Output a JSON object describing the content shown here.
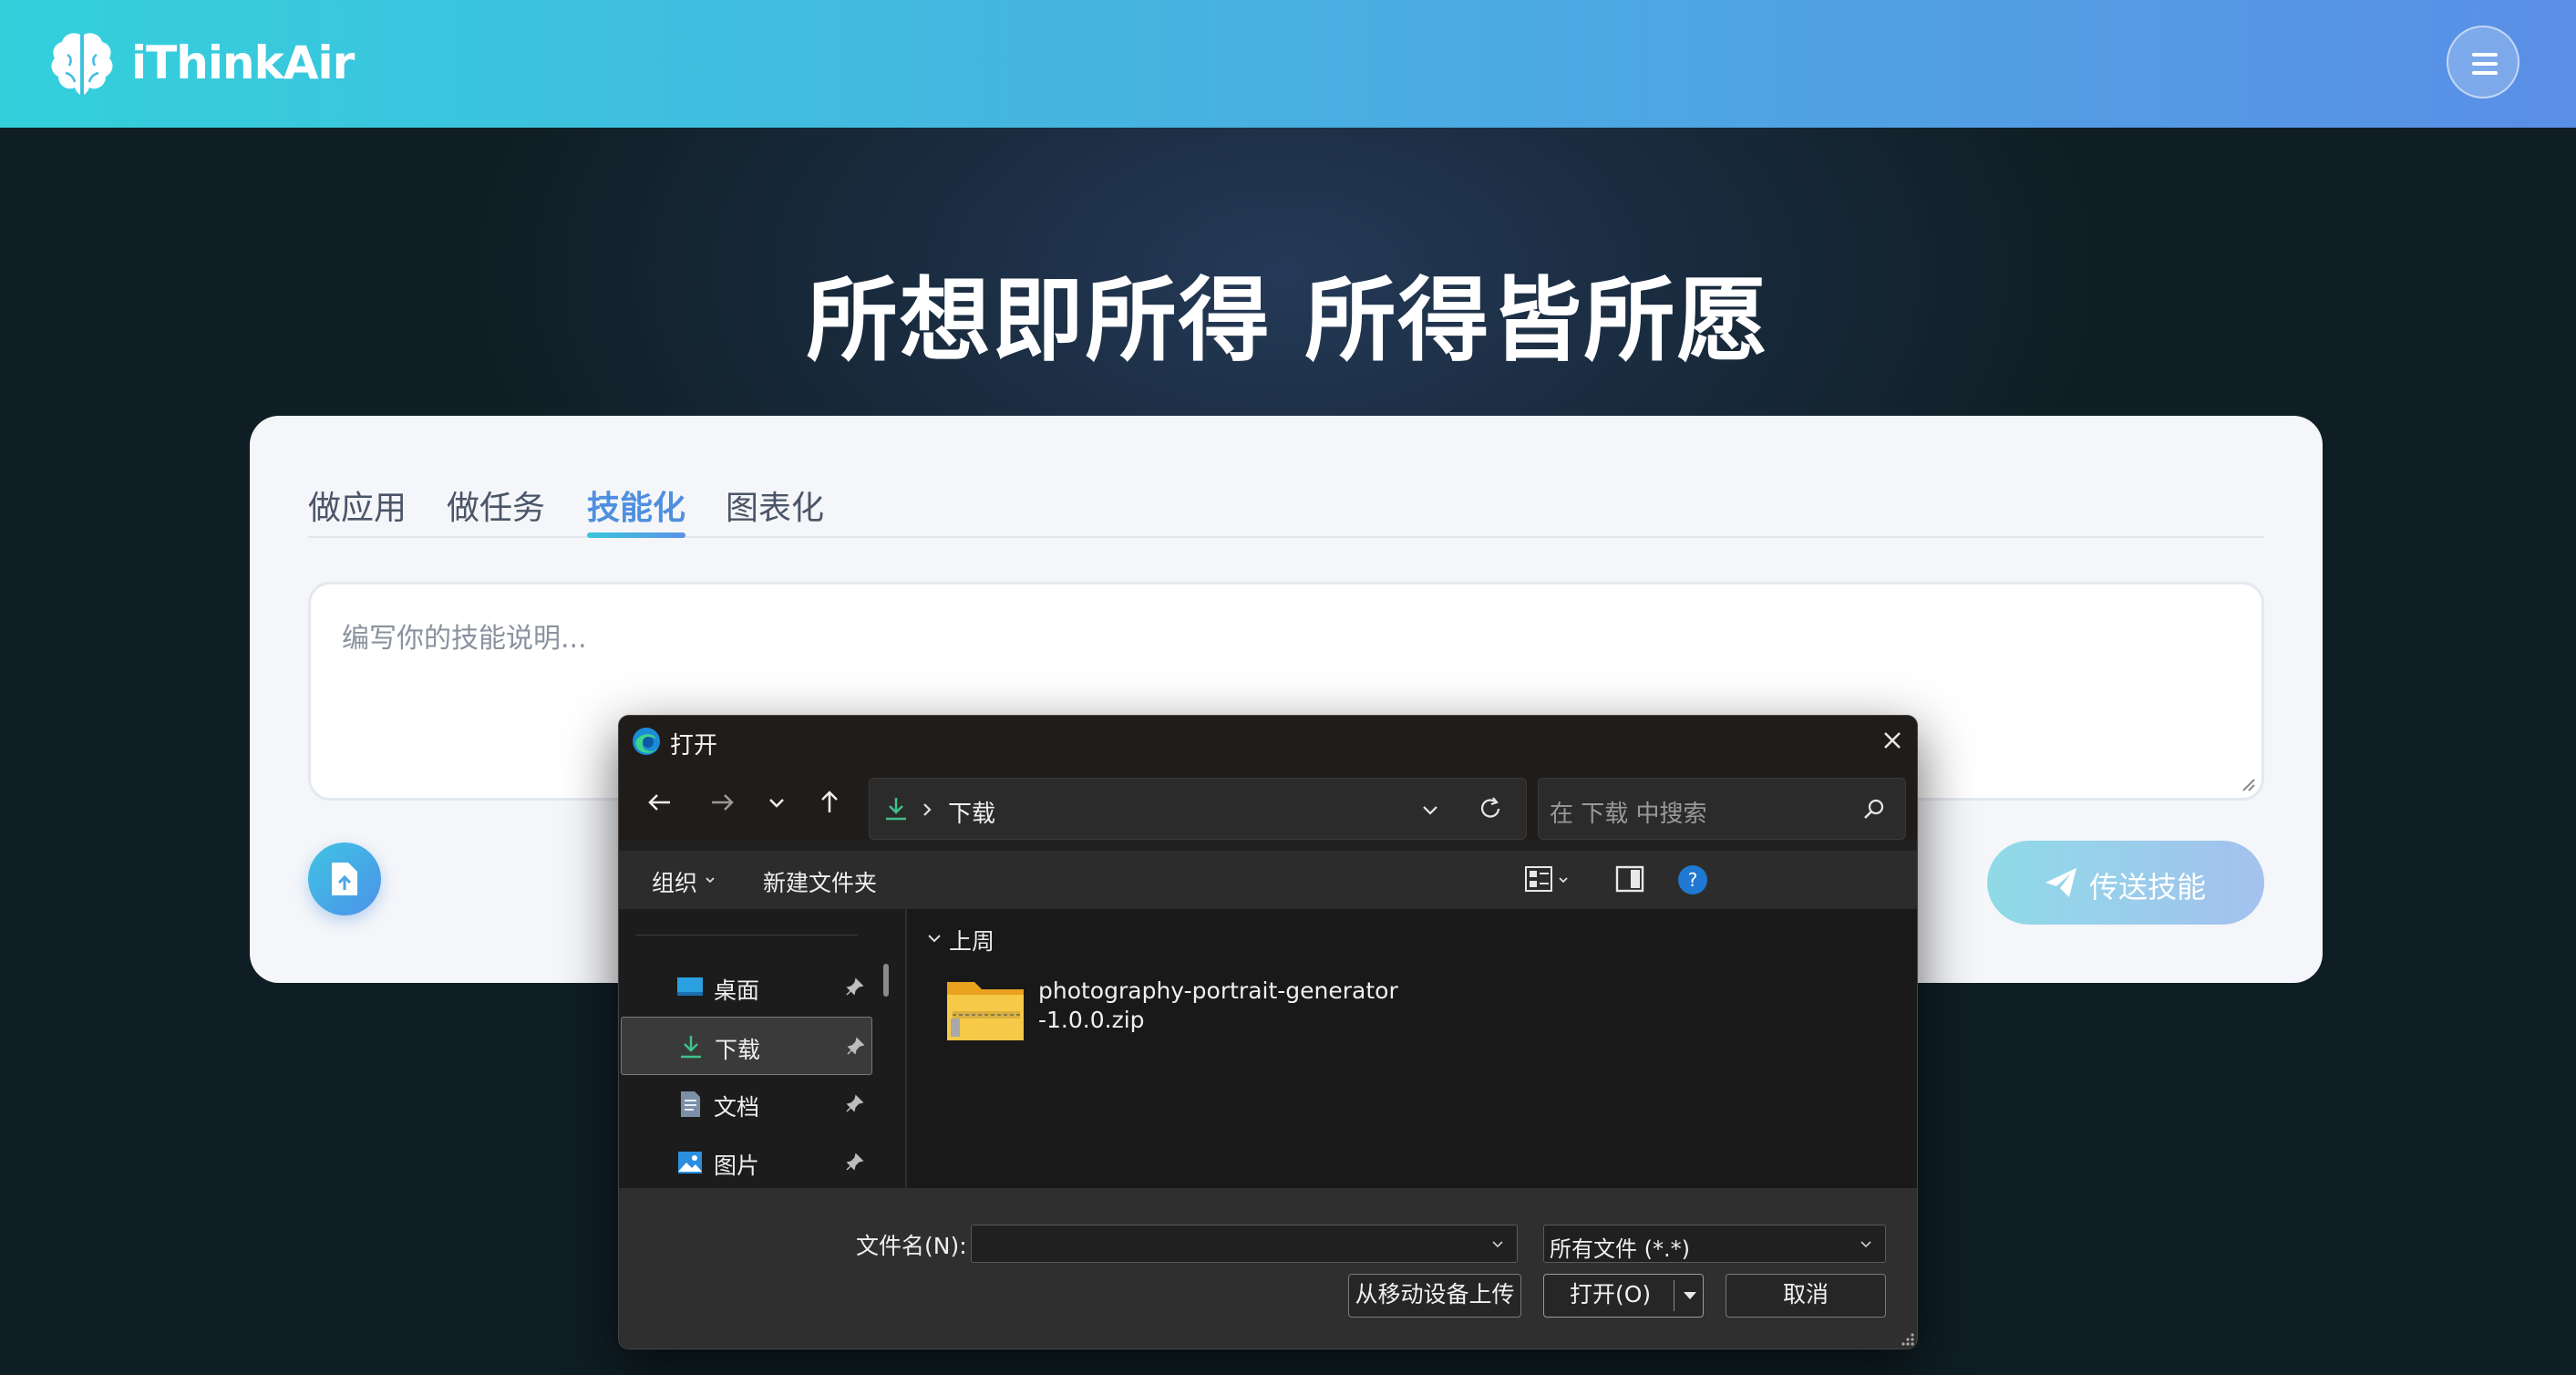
{
  "header": {
    "brand": "iThinkAir",
    "icons": {
      "logo": "brain-icon",
      "menu": "hamburger-menu-icon"
    }
  },
  "hero": {
    "title": "所想即所得 所得皆所愿"
  },
  "card": {
    "tabs": [
      {
        "label": "做应用"
      },
      {
        "label": "做任务"
      },
      {
        "label": "技能化",
        "active": true
      },
      {
        "label": "图表化"
      }
    ],
    "textarea": {
      "placeholder": "编写你的技能说明..."
    },
    "send_label": "传送技能",
    "icons": {
      "upload": "file-upload-icon",
      "send": "paper-plane-icon"
    },
    "colors": {
      "accent": "#4f8fe0"
    }
  },
  "dialog": {
    "title": "打开",
    "address": {
      "location": "下载"
    },
    "search_placeholder": "在 下载 中搜索",
    "toolbar": {
      "organize": "组织",
      "new_folder": "新建文件夹"
    },
    "sidebar": [
      {
        "label": "桌面",
        "icon": "desktop-icon"
      },
      {
        "label": "下载",
        "icon": "download-icon",
        "selected": true
      },
      {
        "label": "文档",
        "icon": "document-icon"
      },
      {
        "label": "图片",
        "icon": "picture-icon"
      }
    ],
    "group_header": "上周",
    "files": [
      {
        "name_line1": "photography-portrait-generator",
        "name_line2": "-1.0.0.zip",
        "icon": "zip-folder-icon"
      }
    ],
    "footer": {
      "filename_label": "文件名(N):",
      "filename_value": "",
      "filetype": "所有文件 (*.*)",
      "upload_mobile": "从移动设备上传",
      "open": "打开(O)",
      "cancel": "取消"
    }
  }
}
